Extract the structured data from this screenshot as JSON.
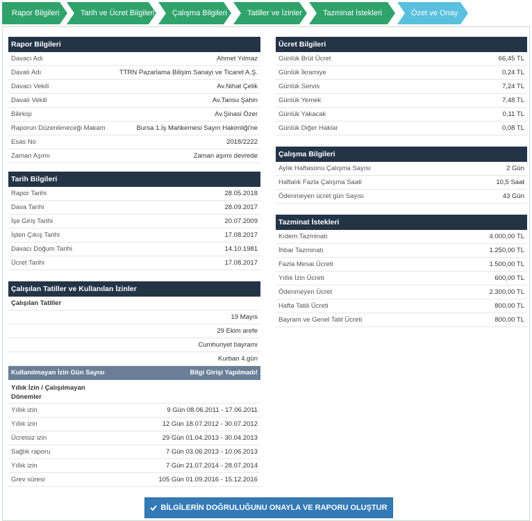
{
  "steps": [
    {
      "label": "Rapor Bilgileri"
    },
    {
      "label": "Tarih ve Ücret Bilgileri"
    },
    {
      "label": "Çalışma Bilgileri"
    },
    {
      "label": "Tatiller ve İzinler"
    },
    {
      "label": "Tazminat İstekleri"
    },
    {
      "label": "Özet ve Onay"
    }
  ],
  "rapor": {
    "title": "Rapor Bilgileri",
    "rows": [
      {
        "k": "Davacı Adı",
        "v": "Ahmet Yılmaz"
      },
      {
        "k": "Davalı Adı",
        "v": "TTRN Pazarlama Bilişim Sanayi ve Ticaret A.Ş."
      },
      {
        "k": "Davacı Vekili",
        "v": "Av.Nihat Çelik"
      },
      {
        "k": "Davalı Vekili",
        "v": "Av.Tansu Şahin"
      },
      {
        "k": "Bilirkişi",
        "v": "Av.Şinasi Özer"
      },
      {
        "k": "Raporun Düzenleneceği Makam",
        "v": "Bursa 1.İş Mahkemesi Sayın Hakimliği'ne"
      },
      {
        "k": "Esas No",
        "v": "2018/2222"
      },
      {
        "k": "Zaman Aşımı",
        "v": "Zaman aşımı devrede"
      }
    ]
  },
  "tarih": {
    "title": "Tarih Bilgileri",
    "rows": [
      {
        "k": "Rapor Tarihi",
        "v": "28.05.2018"
      },
      {
        "k": "Dava Tarihi",
        "v": "28.09.2017"
      },
      {
        "k": "İşe Giriş Tarihi",
        "v": "20.07.2009"
      },
      {
        "k": "İşten Çıkış Tarihi",
        "v": "17.08.2017"
      },
      {
        "k": "Davacı Doğum Tarihi",
        "v": "14.10.1981"
      },
      {
        "k": "Ücret Tarihi",
        "v": "17.08.2017"
      }
    ]
  },
  "tatiller": {
    "title": "Çalışılan Tatiller ve Kullanılan İzinler",
    "sub_label": "Çalışılan Tatiller",
    "holidays": [
      "19 Mayıs",
      "29 Ekim arefe",
      "Cumhuriyet bayramı",
      "Kurban 4.gün"
    ],
    "izin_head": "Kullanılmayan İzin Gün Sayısı",
    "izin_head_right": "Bilgi Girişi Yapılmadı!",
    "izin_sub": "Yıllık İzin / Çalışılmayan Dönemler",
    "izin_rows": [
      {
        "k": "Yıllık izin",
        "v": "9 Gün 08.06.2011 - 17.06.2011"
      },
      {
        "k": "Yıllık izin",
        "v": "12 Gün 18.07.2012 - 30.07.2012"
      },
      {
        "k": "Ücretsiz izin",
        "v": "29 Gün 01.04.2013 - 30.04.2013"
      },
      {
        "k": "Sağlık raporu",
        "v": "7 Gün 03.06.2013 - 10.06.2013"
      },
      {
        "k": "Yıllık izin",
        "v": "7 Gün 21.07.2014 - 28.07.2014"
      },
      {
        "k": "Grev süresi",
        "v": "105 Gün 01.09.2016 - 15.12.2016"
      }
    ]
  },
  "ucret": {
    "title": "Ücret Bilgileri",
    "rows": [
      {
        "k": "Günlük Brüt Ücret",
        "v": "66,45 TL"
      },
      {
        "k": "Günlük İkramiye",
        "v": "0,24 TL"
      },
      {
        "k": "Günlük Servis",
        "v": "7,24 TL"
      },
      {
        "k": "Günlük Yemek",
        "v": "7,48 TL"
      },
      {
        "k": "Günlük Yakacak",
        "v": "0,11 TL"
      },
      {
        "k": "Günlük Diğer Haklar",
        "v": "0,08 TL"
      }
    ]
  },
  "calisma": {
    "title": "Çalışma Bilgileri",
    "rows": [
      {
        "k": "Aylık Haftasonu Çalışma Sayısı",
        "v": "2 Gün"
      },
      {
        "k": "Haftalık Fazla Çalışma Saati",
        "v": "10,5 Saat"
      },
      {
        "k": "Ödenmeyen ücret gün Sayısı",
        "v": "43 Gün"
      }
    ]
  },
  "tazminat": {
    "title": "Tazminat İstekleri",
    "rows": [
      {
        "k": "Kıdem Tazminatı",
        "v": "4.000,00 TL"
      },
      {
        "k": "İhbar Tazminatı",
        "v": "1.250,00 TL"
      },
      {
        "k": "Fazla Mesai Ücreti",
        "v": "1.500,00 TL"
      },
      {
        "k": "Yıllık İzin Ücreti",
        "v": "600,00 TL"
      },
      {
        "k": "Ödenmeyen Ücret",
        "v": "2.300,00 TL"
      },
      {
        "k": "Hafta Tatili Ücreti",
        "v": "800,00 TL"
      },
      {
        "k": "Bayram ve Genel Tatil Ücreti",
        "v": "800,00 TL"
      }
    ]
  },
  "confirm": {
    "label": "BİLGİLERİN DOĞRULUĞUNU ONAYLA VE RAPORU OLUŞTUR"
  },
  "colors": {
    "step": "#2fa36b",
    "step_active": "#5bc0de",
    "section": "#243447",
    "button": "#337ab7"
  }
}
